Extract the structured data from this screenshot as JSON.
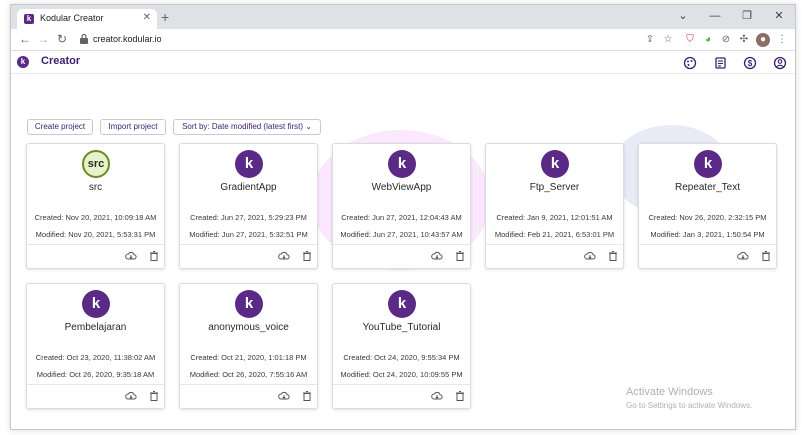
{
  "browser": {
    "tab_title": "Kodular Creator",
    "favicon_letter": "k",
    "close_tab": "✕",
    "new_tab": "+",
    "url": "creator.kodular.io",
    "controls": {
      "minimize": "⌄",
      "restore": "—",
      "maximize": "❐",
      "close": "✕"
    }
  },
  "app": {
    "logo_letter": "k",
    "title": "Creator",
    "accent_color": "#5b2a86"
  },
  "actions": {
    "create_project": "Create project",
    "import_project": "Import project",
    "sort_by": "Sort by: Date modified (latest first)"
  },
  "projects": [
    {
      "name": "src",
      "created": "Created: Nov 20, 2021, 10:09:18 AM",
      "modified": "Modified: Nov 20, 2021, 5:53:31 PM",
      "logo": "src"
    },
    {
      "name": "GradientApp",
      "created": "Created: Jun 27, 2021, 5:29:23 PM",
      "modified": "Modified: Jun 27, 2021, 5:32:51 PM",
      "logo": "k"
    },
    {
      "name": "WebViewApp",
      "created": "Created: Jun 27, 2021, 12:04:43 AM",
      "modified": "Modified: Jun 27, 2021, 10:43:57 AM",
      "logo": "k"
    },
    {
      "name": "Ftp_Server",
      "created": "Created: Jan 9, 2021, 12:01:51 AM",
      "modified": "Modified: Feb 21, 2021, 6:53:01 PM",
      "logo": "k"
    },
    {
      "name": "Repeater_Text",
      "created": "Created: Nov 26, 2020, 2:32:15 PM",
      "modified": "Modified: Jan 3, 2021, 1:50:54 PM",
      "logo": "k"
    },
    {
      "name": "Pembelajaran",
      "created": "Created: Oct 23, 2020, 11:38:02 AM",
      "modified": "Modified: Oct 26, 2020, 9:35:18 AM",
      "logo": "k"
    },
    {
      "name": "anonymous_voice",
      "created": "Created: Oct 21, 2020, 1:01:18 PM",
      "modified": "Modified: Oct 26, 2020, 7:55:16 AM",
      "logo": "k"
    },
    {
      "name": "YouTube_Tutorial",
      "created": "Created: Oct 24, 2020, 9:55:34 PM",
      "modified": "Modified: Oct 24, 2020, 10:09:55 PM",
      "logo": "k"
    }
  ],
  "watermark": {
    "title": "Activate Windows",
    "subtitle": "Go to Settings to activate Windows."
  }
}
